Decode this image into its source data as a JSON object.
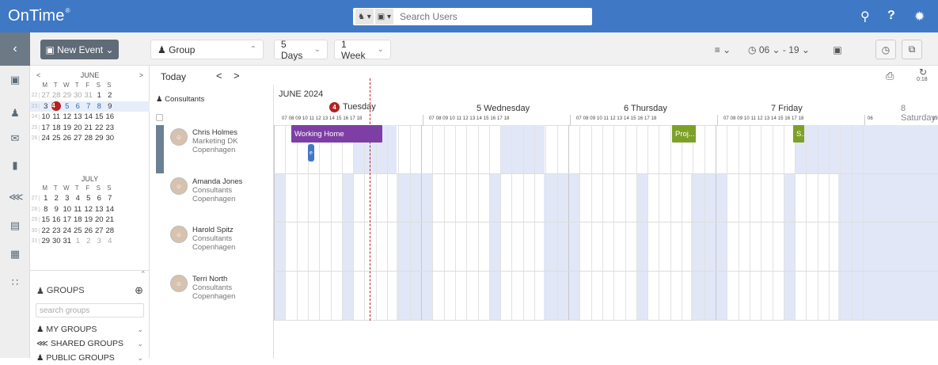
{
  "app": {
    "brand": "OnTime",
    "brand_mark": "®"
  },
  "topbar": {
    "search_placeholder": "Search Users",
    "icons": [
      "user-chip-icon",
      "calendar-chip-icon",
      "search-zoom-icon",
      "help-icon",
      "settings-icon"
    ],
    "help_label": "?"
  },
  "toolbar": {
    "new_event_label": "New Event",
    "group_label": "Group",
    "days_label": "5 Days",
    "period_label": "1 Week",
    "time_from": "06",
    "time_to": "19",
    "time_sep": "-"
  },
  "nav": {
    "today_label": "Today",
    "prev": "<",
    "next": ">",
    "sync_label": "0:18"
  },
  "mini_calendars": [
    {
      "month": "JUNE",
      "dow": [
        "M",
        "T",
        "W",
        "T",
        "F",
        "S",
        "S"
      ],
      "weeks": [
        {
          "wk": "22",
          "days": [
            "27",
            "28",
            "29",
            "30",
            "31",
            "1",
            "2"
          ]
        },
        {
          "wk": "23",
          "days": [
            "3",
            "4",
            "5",
            "6",
            "7",
            "8",
            "9"
          ]
        },
        {
          "wk": "24",
          "days": [
            "10",
            "11",
            "12",
            "13",
            "14",
            "15",
            "16"
          ]
        },
        {
          "wk": "25",
          "days": [
            "17",
            "18",
            "19",
            "20",
            "21",
            "22",
            "23"
          ]
        },
        {
          "wk": "26",
          "days": [
            "24",
            "25",
            "26",
            "27",
            "28",
            "29",
            "30"
          ]
        }
      ],
      "today": "4"
    },
    {
      "month": "JULY",
      "dow": [
        "M",
        "T",
        "W",
        "T",
        "F",
        "S",
        "S"
      ],
      "weeks": [
        {
          "wk": "27",
          "days": [
            "1",
            "2",
            "3",
            "4",
            "5",
            "6",
            "7"
          ]
        },
        {
          "wk": "28",
          "days": [
            "8",
            "9",
            "10",
            "11",
            "12",
            "13",
            "14"
          ]
        },
        {
          "wk": "29",
          "days": [
            "15",
            "16",
            "17",
            "18",
            "19",
            "20",
            "21"
          ]
        },
        {
          "wk": "30",
          "days": [
            "22",
            "23",
            "24",
            "25",
            "26",
            "27",
            "28"
          ]
        },
        {
          "wk": "31",
          "days": [
            "29",
            "30",
            "31",
            "1",
            "2",
            "3",
            "4"
          ]
        }
      ]
    }
  ],
  "groups": {
    "title": "GROUPS",
    "search_placeholder": "search groups",
    "items": [
      "MY GROUPS",
      "SHARED GROUPS",
      "PUBLIC GROUPS"
    ]
  },
  "calendar": {
    "people_header": "Consultants",
    "month_label": "JUNE 2024",
    "days": [
      {
        "num": "4",
        "name": "Tuesday",
        "today": true
      },
      {
        "num": "5",
        "name": "Wednesday"
      },
      {
        "num": "6",
        "name": "Thursday"
      },
      {
        "num": "7",
        "name": "Friday"
      },
      {
        "num": "8",
        "name": "Saturday"
      }
    ],
    "hours": "07 08 09 10 11 12 13 14 15 16 17 18",
    "saturday_hours": [
      "06",
      "19"
    ]
  },
  "people": [
    {
      "name": "Chris Holmes",
      "dept": "Marketing DK",
      "city": "Copenhagen"
    },
    {
      "name": "Amanda Jones",
      "dept": "Consultants",
      "city": "Copenhagen"
    },
    {
      "name": "Harold Spitz",
      "dept": "Consultants",
      "city": "Copenhagen"
    },
    {
      "name": "Terri North",
      "dept": "Consultants",
      "city": "Copenhagen"
    }
  ],
  "events": [
    {
      "title": "Working Home",
      "color": "#7e3fa5"
    },
    {
      "title": "e",
      "color": "#3f79c6"
    },
    {
      "title": "Proj...",
      "color": "#7da128"
    },
    {
      "title": "S..",
      "color": "#7da128"
    }
  ],
  "colors": {
    "topbar": "#3f79c6",
    "today_badge": "#b22222",
    "free_time": "#e2e7f7"
  }
}
